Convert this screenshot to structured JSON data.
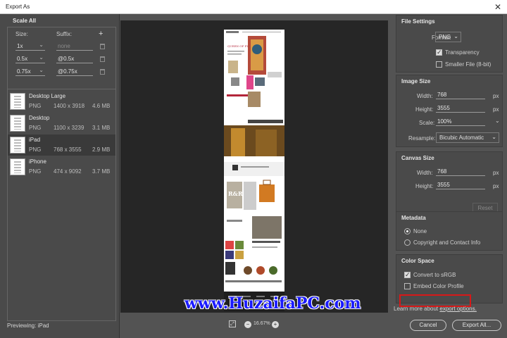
{
  "window": {
    "title": "Export As",
    "close_glyph": "✕"
  },
  "scale_all": {
    "heading": "Scale All",
    "size_label": "Size:",
    "suffix_label": "Suffix:",
    "add_glyph": "+",
    "rows": [
      {
        "size": "1x",
        "suffix": "none"
      },
      {
        "size": "0.5x",
        "suffix": "@0.5x"
      },
      {
        "size": "0.75x",
        "suffix": "@0.75x"
      }
    ]
  },
  "presets": [
    {
      "name": "Desktop Large",
      "format": "PNG",
      "dims": "1400 x 3918",
      "size": "4.6 MB",
      "selected": false
    },
    {
      "name": "Desktop",
      "format": "PNG",
      "dims": "1100 x 3239",
      "size": "3.1 MB",
      "selected": false
    },
    {
      "name": "iPad",
      "format": "PNG",
      "dims": "768 x 3555",
      "size": "2.9 MB",
      "selected": true
    },
    {
      "name": "iPhone",
      "format": "PNG",
      "dims": "474 x 9092",
      "size": "3.7 MB",
      "selected": false
    }
  ],
  "previewing": "Previewing: iPad",
  "zoom": {
    "value": "16.67%",
    "minus": "−",
    "plus": "+",
    "fit_glyph": "⤢"
  },
  "preview_page": {
    "headline": "QUEEN OF FLORA",
    "letters": "R&R"
  },
  "watermark": "www.HuzaifaPC.com",
  "file_settings": {
    "heading": "File Settings",
    "format_label": "Format:",
    "format_value": "PNG",
    "transparency_label": "Transparency",
    "transparency_checked": true,
    "smaller_label": "Smaller File (8-bit)",
    "smaller_checked": false
  },
  "image_size": {
    "heading": "Image Size",
    "width_label": "Width:",
    "width_value": "768",
    "height_label": "Height:",
    "height_value": "3555",
    "scale_label": "Scale:",
    "scale_value": "100%",
    "resample_label": "Resample:",
    "resample_value": "Bicubic Automatic",
    "unit": "px"
  },
  "canvas_size": {
    "heading": "Canvas Size",
    "width_label": "Width:",
    "width_value": "768",
    "height_label": "Height:",
    "height_value": "3555",
    "unit": "px",
    "reset_label": "Reset"
  },
  "metadata": {
    "heading": "Metadata",
    "none_label": "None",
    "copyright_label": "Copyright and Contact Info",
    "selected": "None"
  },
  "color_space": {
    "heading": "Color Space",
    "convert_label": "Convert to sRGB",
    "convert_checked": true,
    "embed_label": "Embed Color Profile",
    "embed_checked": false
  },
  "footer": {
    "learn_prefix": "Learn more about ",
    "learn_link": "export options.",
    "cancel_label": "Cancel",
    "export_label": "Export All..."
  },
  "colors": {
    "highlight": "#d81818",
    "watermark": "#1b1bff"
  }
}
